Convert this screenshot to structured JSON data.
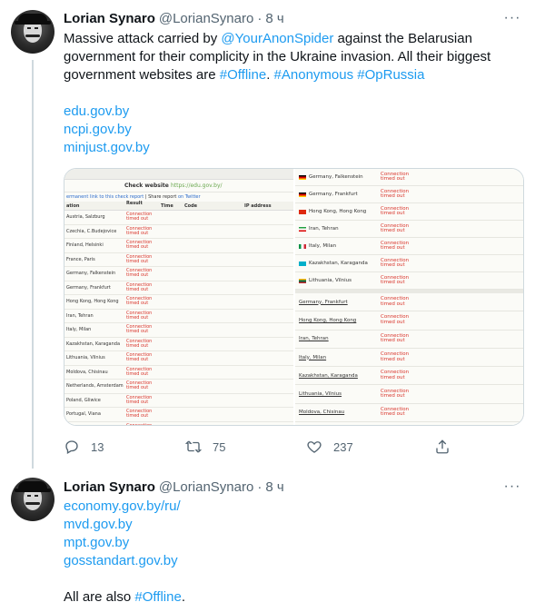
{
  "tweet1": {
    "name": "Lorian Synaro",
    "handle": "@LorianSynaro",
    "dot": "·",
    "time": "8 ч",
    "more": "···",
    "text": {
      "p1": "Massive attack carried by ",
      "mention": "@YourAnonSpider",
      "p2": " against the Belarusian government for their complicity in the Ukraine invasion. All their biggest government websites are ",
      "tag1": "#Offline",
      "p3": ". ",
      "tag2": "#Anonymous",
      "p4": " ",
      "tag3": "#OpRussia"
    },
    "links": [
      "edu.gov.by",
      "ncpi.gov.by",
      "minjust.gov.by"
    ],
    "media_left": {
      "title": "Check website",
      "url": "https://edu.gov.by/",
      "sub_link": "ermanent link to this check report",
      "sub_sep": " | ",
      "sub_share": "Share report",
      "sub_on": " on Twitter",
      "headers": {
        "loc": "ation",
        "res": "Result",
        "time": "Time",
        "code": "Code",
        "ip": "IP address"
      },
      "result_l1": "Connection",
      "result_l2": "timed out",
      "rows": [
        "Austria, Salzburg",
        "Czechia, C.Budejovice",
        "Finland, Helsinki",
        "France, Paris",
        "Germany, Falkenstein",
        "Germany, Frankfurt",
        "Hong Kong, Hong Kong",
        "Iran, Tehran",
        "Italy, Milan",
        "Kazakhstan, Karaganda",
        "Lithuania, Vilnius",
        "Moldova, Chisinau",
        "Netherlands, Amsterdam",
        "Poland, Gliwice",
        "Portugal, Viana",
        ""
      ]
    },
    "media_right": {
      "result_l1": "Connection",
      "result_l2": "timed out",
      "top_rows": [
        {
          "loc": "Germany, Falkenstein",
          "flag": "de"
        },
        {
          "loc": "Germany, Frankfurt",
          "flag": "de"
        },
        {
          "loc": "Hong Kong, Hong Kong",
          "flag": "hk"
        },
        {
          "loc": "Iran, Tehran",
          "flag": "ir"
        },
        {
          "loc": "Italy, Milan",
          "flag": "it"
        },
        {
          "loc": "Kazakhstan, Karaganda",
          "flag": "kz"
        },
        {
          "loc": "Lithuania, Vilnius",
          "flag": "lt"
        }
      ],
      "bottom_rows": [
        "Germany, Frankfurt",
        "Hong Kong, Hong Kong",
        "Iran, Tehran",
        "Italy, Milan",
        "Kazakhstan, Karaganda",
        "Lithuania, Vilnius",
        "Moldova, Chisinau"
      ]
    },
    "stats": {
      "replies": "13",
      "retweets": "75",
      "likes": "237"
    }
  },
  "tweet2": {
    "name": "Lorian Synaro",
    "handle": "@LorianSynaro",
    "dot": "·",
    "time": "8 ч",
    "more": "···",
    "links": [
      "economy.gov.by/ru/",
      "mvd.gov.by",
      "mpt.gov.by",
      "gosstandart.gov.by"
    ],
    "text_a": "All are also ",
    "tag": "#Offline",
    "text_b": "."
  },
  "colors": {
    "link": "#1d9bf0",
    "text": "#0f1419",
    "muted": "#536471",
    "thread": "#cfd9de",
    "error": "#d9342b"
  }
}
